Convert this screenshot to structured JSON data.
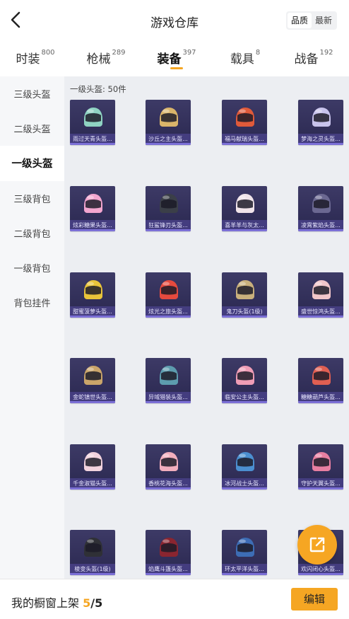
{
  "header": {
    "title": "游戏仓库",
    "sort_options": [
      "品质",
      "最新"
    ],
    "sort_active": 0
  },
  "tabs": [
    {
      "label": "时装",
      "count": "800"
    },
    {
      "label": "枪械",
      "count": "289"
    },
    {
      "label": "装备",
      "count": "397",
      "active": true
    },
    {
      "label": "载具",
      "count": "8"
    },
    {
      "label": "战备",
      "count": "192"
    }
  ],
  "sidebar": [
    "三级头盔",
    "二级头盔",
    "一级头盔",
    "三级背包",
    "二级背包",
    "一级背包",
    "背包挂件"
  ],
  "sidebar_active": 2,
  "section": {
    "title": "一级头盔: 50件"
  },
  "items": [
    {
      "name": "雨过天青头盔...",
      "color": "#8fd3c2"
    },
    {
      "name": "沙丘之主头盔...",
      "color": "#d9b46a"
    },
    {
      "name": "福马献瑞头盔...",
      "color": "#e05a3a"
    },
    {
      "name": "梦海之灵头盔...",
      "color": "#c8c3ec"
    },
    {
      "name": "炫彩糖果头盔...",
      "color": "#f3a6cf"
    },
    {
      "name": "狂鲨锋刃头盔...",
      "color": "#3b3f48"
    },
    {
      "name": "喜羊羊与灰太...",
      "color": "#f0e4ea"
    },
    {
      "name": "凌霄紫焰头盔...",
      "color": "#6b6891"
    },
    {
      "name": "甜蜜菠萝头盔...",
      "color": "#e9c43a"
    },
    {
      "name": "炫光之旅头盔...",
      "color": "#e54a3e"
    },
    {
      "name": "鬼刀头盔(1级)",
      "color": "#c9b07c"
    },
    {
      "name": "盛世惊鸿头盔...",
      "color": "#f1c6c9"
    },
    {
      "name": "金蛇镇世头盔...",
      "color": "#caa56a"
    },
    {
      "name": "异域猎装头盔...",
      "color": "#5d9cae"
    },
    {
      "name": "临安公主头盔...",
      "color": "#ef9db6"
    },
    {
      "name": "糖糖葫芦头盔...",
      "color": "#e05f52"
    },
    {
      "name": "千金淑猫头盔...",
      "color": "#f2d3de"
    },
    {
      "name": "香桃花海头盔...",
      "color": "#f2aebd"
    },
    {
      "name": "冰河战士头盔...",
      "color": "#4b8fd0"
    },
    {
      "name": "守护天翼头盔...",
      "color": "#e87fa1"
    },
    {
      "name": "棱变头盔(1级)",
      "color": "#2f3036"
    },
    {
      "name": "焰鹰斗篷头盔...",
      "color": "#8a2530"
    },
    {
      "name": "环太平洋头盔...",
      "color": "#3d6db5"
    },
    {
      "name": "欢闪闭心头盔...",
      "color": "#c78fb8"
    }
  ],
  "footer": {
    "label": "我的橱窗上架",
    "current": "5",
    "total": "/5",
    "edit": "编辑"
  },
  "colors": {
    "accent": "#f5a623",
    "card_bg": "#2f2c58",
    "card_band": "#7b6fd6"
  }
}
